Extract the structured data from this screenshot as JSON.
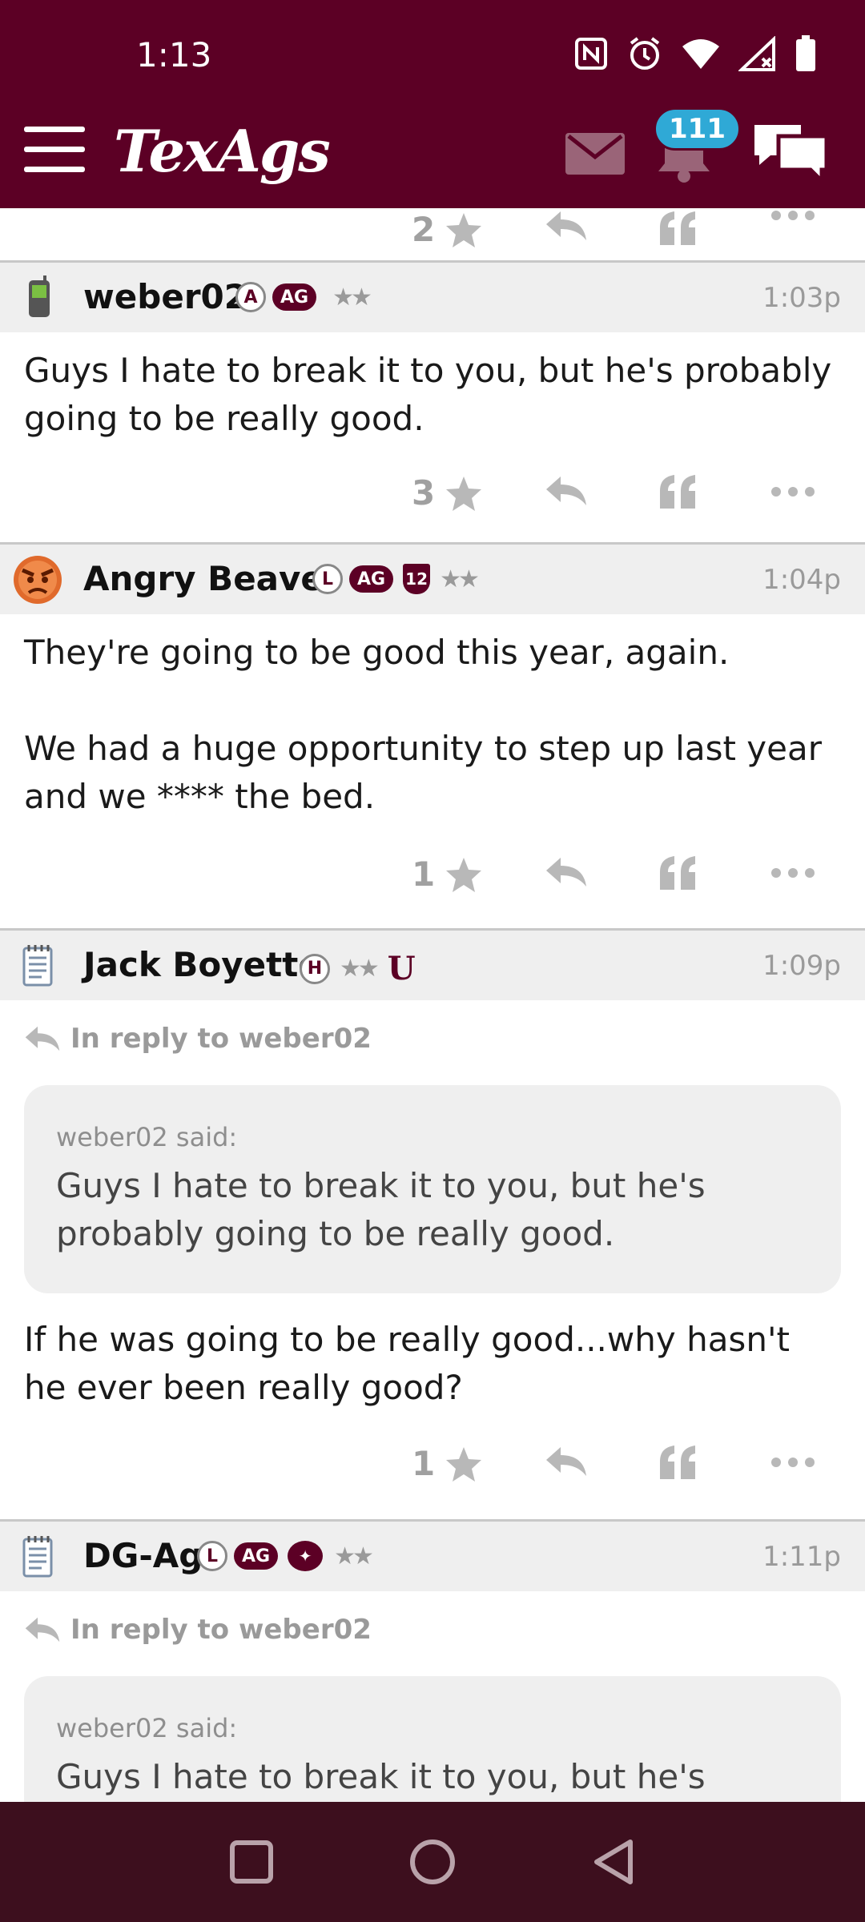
{
  "status": {
    "time": "1:13"
  },
  "header": {
    "logo": "TexAgs",
    "notification_count": "111"
  },
  "colors": {
    "brand": "#5c0025",
    "badge": "#2fa9d6",
    "navbar": "#3d0f1e"
  },
  "top_actions": {
    "like_count": "2"
  },
  "posts": [
    {
      "username": "weber02",
      "avatar": "phone-icon",
      "badges": [
        "A",
        "AG"
      ],
      "stars": "★★",
      "time": "1:03p",
      "body": "Guys I hate to break it to you, but he's probably going to be really good.",
      "like_count": "3"
    },
    {
      "username": "Angry Beaver",
      "avatar": "angry-face-icon",
      "badges": [
        "L",
        "AG",
        "12"
      ],
      "stars": "★★",
      "time": "1:04p",
      "body": "They're going to be good this year, again.\n\nWe had a huge opportunity to step up last year and we **** the bed.",
      "like_count": "1"
    },
    {
      "username": "Jack Boyette",
      "avatar": "notepad-icon",
      "badges": [
        "H"
      ],
      "stars": "★★",
      "extra_badge": "U",
      "time": "1:09p",
      "in_reply": "In reply to weber02",
      "quote_attr": "weber02 said:",
      "quote_text": "Guys I hate to break it to you, but he's probably going to be really good.",
      "body": "If he was going to be really good...why hasn't he ever been really good?",
      "like_count": "1"
    },
    {
      "username": "DG-Ag",
      "avatar": "notepad-icon",
      "badges": [
        "L",
        "AG"
      ],
      "stars": "★★",
      "time": "1:11p",
      "in_reply": "In reply to weber02",
      "quote_attr": "weber02 said:",
      "quote_text": "Guys I hate to break it to you, but he's"
    }
  ]
}
